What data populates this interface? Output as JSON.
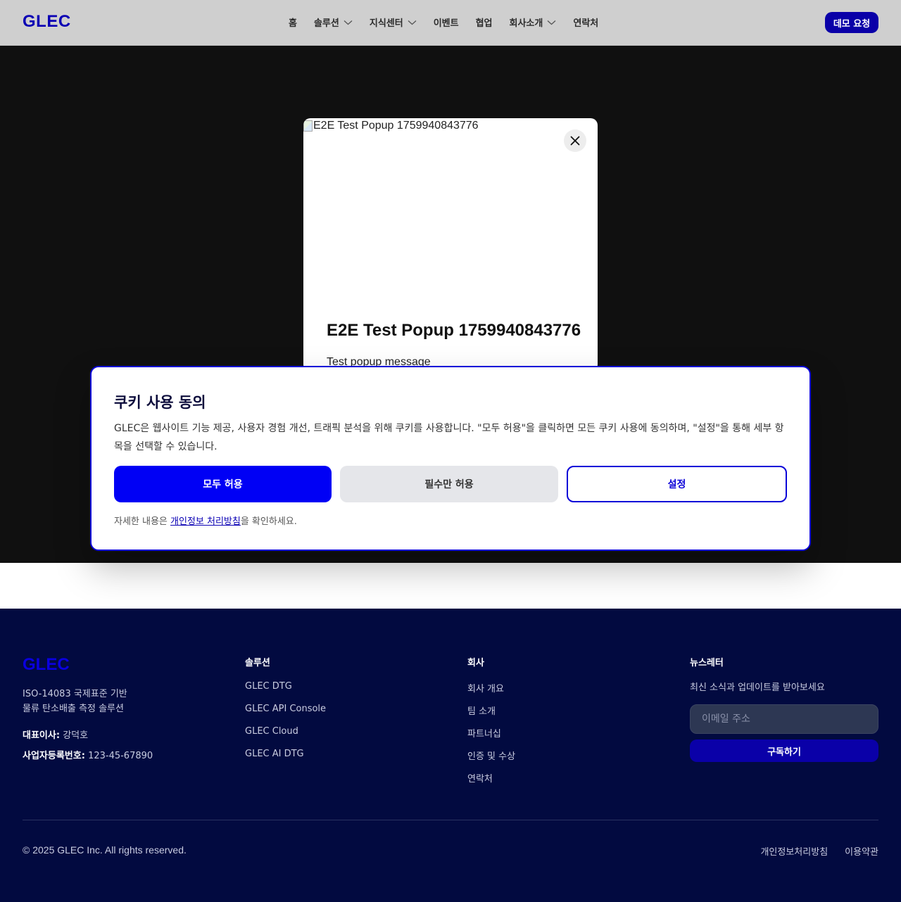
{
  "header": {
    "logo": "GLEC",
    "nav": [
      {
        "label": "홈",
        "has_dropdown": false
      },
      {
        "label": "솔루션",
        "has_dropdown": true
      },
      {
        "label": "지식센터",
        "has_dropdown": true
      },
      {
        "label": "이벤트",
        "has_dropdown": false
      },
      {
        "label": "협업",
        "has_dropdown": false
      },
      {
        "label": "회사소개",
        "has_dropdown": true
      },
      {
        "label": "연락처",
        "has_dropdown": false
      }
    ],
    "demo_button": "데모 요청"
  },
  "popup": {
    "image_alt": "E2E Test Popup 1759940843776",
    "title": "E2E Test Popup 1759940843776",
    "message": "Test popup message",
    "close_icon": "close-icon"
  },
  "cookie": {
    "title": "쿠키 사용 동의",
    "description": "GLEC은 웹사이트 기능 제공, 사용자 경험 개선, 트래픽 분석을 위해 쿠키를 사용합니다. \"모두 허용\"을 클릭하면 모든 쿠키 사용에 동의하며, \"설정\"을 통해 세부 항목을 선택할 수 있습니다.",
    "allow_all": "모두 허용",
    "essential_only": "필수만 허용",
    "settings": "설정",
    "note_prefix": "자세한 내용은 ",
    "note_link": "개인정보 처리방침",
    "note_suffix": "을 확인하세요."
  },
  "footer": {
    "logo": "GLEC",
    "tagline_line1": "ISO-14083 국제표준 기반",
    "tagline_line2": "물류 탄소배출 측정 솔루션",
    "ceo_label": "대표이사:",
    "ceo_value": "강덕호",
    "biz_label": "사업자등록번호:",
    "biz_value": "123-45-67890",
    "solutions_title": "솔루션",
    "solutions": [
      "GLEC DTG",
      "GLEC API Console",
      "GLEC Cloud",
      "GLEC AI DTG"
    ],
    "company_title": "회사",
    "company": [
      "회사 개요",
      "팀 소개",
      "파트너십",
      "인증 및 수상",
      "연락처"
    ],
    "newsletter_title": "뉴스레터",
    "newsletter_desc": "최신 소식과 업데이트를 받아보세요",
    "email_placeholder": "이메일 주소",
    "subscribe": "구독하기",
    "copyright": "© 2025 GLEC Inc. All rights reserved.",
    "privacy": "개인정보처리방침",
    "terms": "이용약관"
  },
  "colors": {
    "brand": "#0a00b4",
    "primary_button": "#0000f5",
    "footer_bg": "#020a40",
    "overlay": "#101010"
  }
}
